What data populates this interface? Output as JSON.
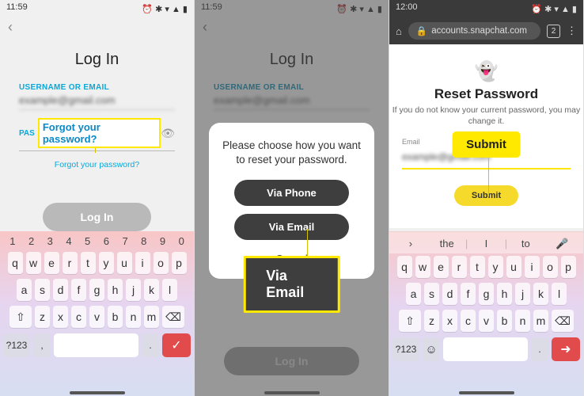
{
  "status": {
    "time1": "11:59",
    "time2": "11:59",
    "time3": "12:00",
    "icons": "⏰ ✱ ▾ ▲ ▮"
  },
  "screen1": {
    "title": "Log In",
    "username_label": "USERNAME OR EMAIL",
    "username_value": "example@gmail.com",
    "password_short": "PAS",
    "forgot_callout": "Forgot your password?",
    "forgot_link": "Forgot your password?",
    "login_btn": "Log In"
  },
  "screen2": {
    "modal_text": "Please choose how you want to reset your password.",
    "via_phone": "Via Phone",
    "via_email": "Via Email",
    "cancel": "Cancel",
    "callout": "Via Email",
    "login_btn": "Log In"
  },
  "screen3": {
    "url": "accounts.snapchat.com",
    "tab_count": "2",
    "title": "Reset Password",
    "subtitle": "If you do not know your current password, you may change it.",
    "email_label": "Email",
    "email_value": "example@gmail.com",
    "submit": "Submit",
    "callout": "Submit"
  },
  "keyboard": {
    "nums": [
      "1",
      "2",
      "3",
      "4",
      "5",
      "6",
      "7",
      "8",
      "9",
      "0"
    ],
    "r1": [
      "q",
      "w",
      "e",
      "r",
      "t",
      "y",
      "u",
      "i",
      "o",
      "p"
    ],
    "r2": [
      "a",
      "s",
      "d",
      "f",
      "g",
      "h",
      "j",
      "k",
      "l"
    ],
    "r3": [
      "z",
      "x",
      "c",
      "v",
      "b",
      "n",
      "m"
    ],
    "sym": "?123",
    "sug": {
      "chev": "›",
      "w1": "the",
      "w2": "I",
      "w3": "to"
    }
  }
}
